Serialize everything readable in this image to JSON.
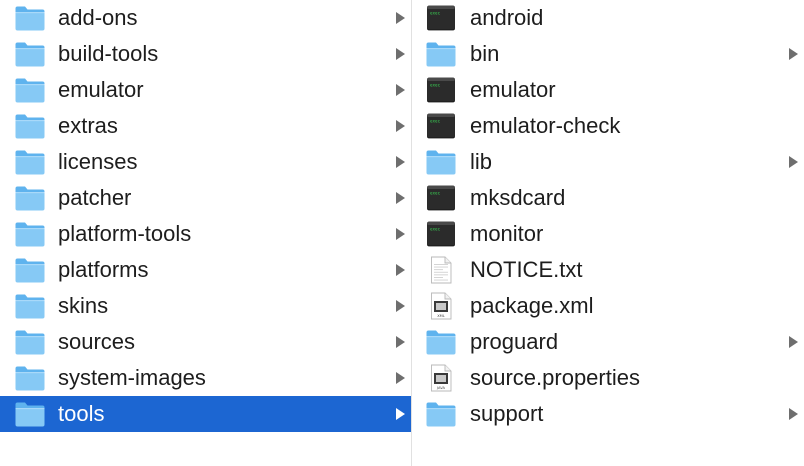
{
  "colors": {
    "selection": "#1c66d2",
    "folder_body": "#86c9f5",
    "folder_tab": "#5fb3ee",
    "terminal_body": "#2b2b2b",
    "chevron": "#6e6e6e"
  },
  "left_column": {
    "items": [
      {
        "label": "add-ons",
        "icon": "folder-icon",
        "has_children": true,
        "selected": false
      },
      {
        "label": "build-tools",
        "icon": "folder-icon",
        "has_children": true,
        "selected": false
      },
      {
        "label": "emulator",
        "icon": "folder-icon",
        "has_children": true,
        "selected": false
      },
      {
        "label": "extras",
        "icon": "folder-icon",
        "has_children": true,
        "selected": false
      },
      {
        "label": "licenses",
        "icon": "folder-icon",
        "has_children": true,
        "selected": false
      },
      {
        "label": "patcher",
        "icon": "folder-icon",
        "has_children": true,
        "selected": false
      },
      {
        "label": "platform-tools",
        "icon": "folder-icon",
        "has_children": true,
        "selected": false
      },
      {
        "label": "platforms",
        "icon": "folder-icon",
        "has_children": true,
        "selected": false
      },
      {
        "label": "skins",
        "icon": "folder-icon",
        "has_children": true,
        "selected": false
      },
      {
        "label": "sources",
        "icon": "folder-icon",
        "has_children": true,
        "selected": false
      },
      {
        "label": "system-images",
        "icon": "folder-icon",
        "has_children": true,
        "selected": false
      },
      {
        "label": "tools",
        "icon": "folder-icon",
        "has_children": true,
        "selected": true
      }
    ]
  },
  "right_column": {
    "items": [
      {
        "label": "android",
        "icon": "terminal-icon",
        "has_children": false
      },
      {
        "label": "bin",
        "icon": "folder-icon",
        "has_children": true
      },
      {
        "label": "emulator",
        "icon": "terminal-icon",
        "has_children": false
      },
      {
        "label": "emulator-check",
        "icon": "terminal-icon",
        "has_children": false
      },
      {
        "label": "lib",
        "icon": "folder-icon",
        "has_children": true
      },
      {
        "label": "mksdcard",
        "icon": "terminal-icon",
        "has_children": false
      },
      {
        "label": "monitor",
        "icon": "terminal-icon",
        "has_children": false
      },
      {
        "label": "NOTICE.txt",
        "icon": "text-document-icon",
        "has_children": false
      },
      {
        "label": "package.xml",
        "icon": "xml-document-icon",
        "has_children": false
      },
      {
        "label": "proguard",
        "icon": "folder-icon",
        "has_children": true
      },
      {
        "label": "source.properties",
        "icon": "java-document-icon",
        "has_children": false
      },
      {
        "label": "support",
        "icon": "folder-icon",
        "has_children": true
      }
    ]
  },
  "icon_badges": {
    "terminal": "exec",
    "xml": "XML",
    "java": "JAVA"
  }
}
